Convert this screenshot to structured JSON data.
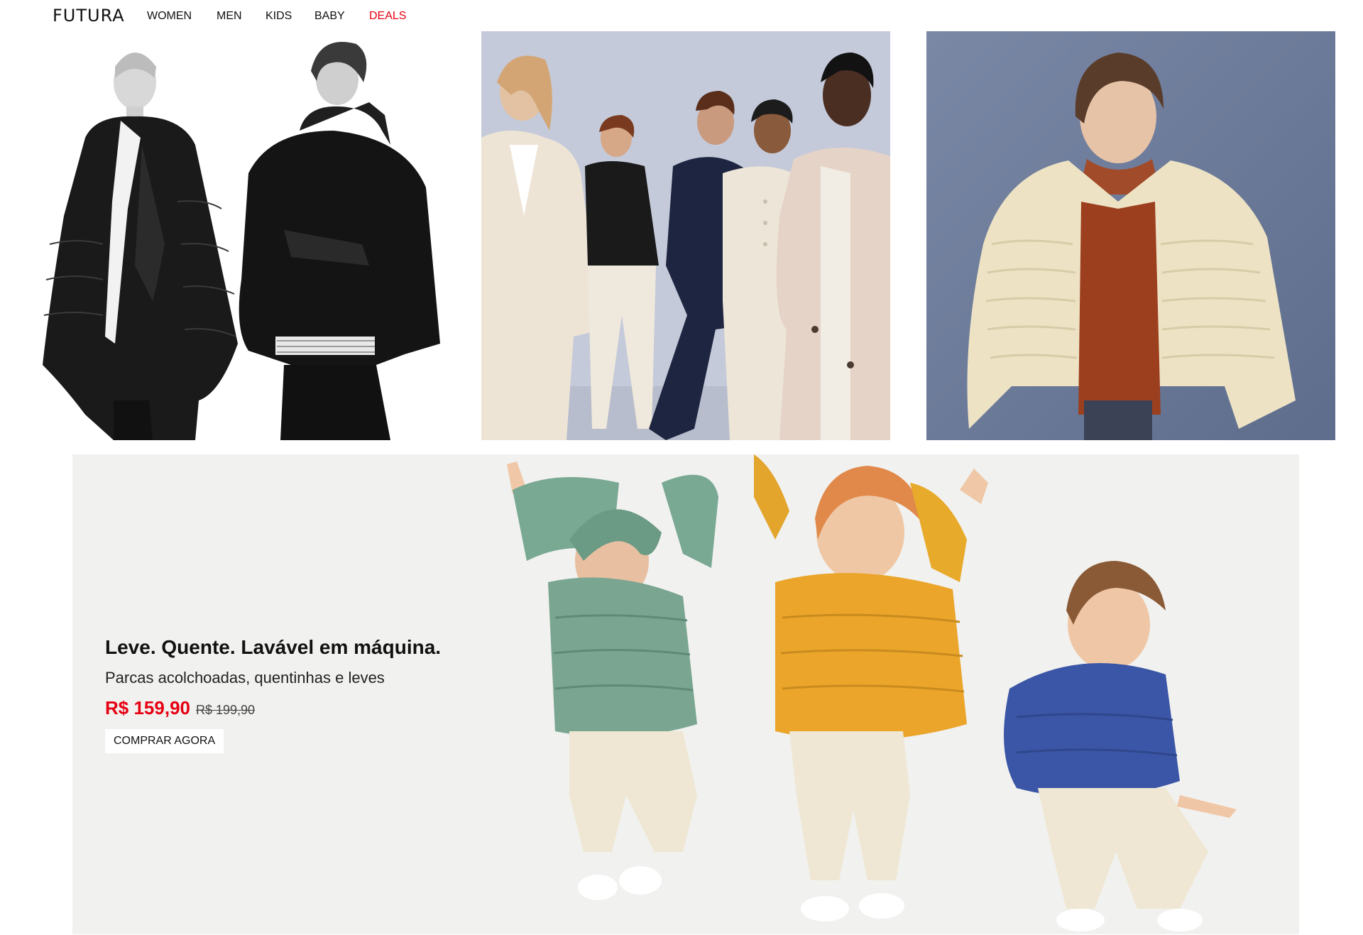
{
  "header": {
    "logo": "FUTURA",
    "nav": {
      "women": "WOMEN",
      "men": "MEN",
      "kids": "KIDS",
      "baby": "BABY",
      "deals": "DEALS"
    }
  },
  "colors": {
    "accent": "#e60012",
    "text": "#111111",
    "hero_bg": "#f1f1ef"
  },
  "tiles": [
    {
      "name": "women-men-outerwear-tile",
      "scene": "two-models-black-puffer-coats"
    },
    {
      "name": "group-models-tile",
      "scene": "five-models-neutral-outfits"
    },
    {
      "name": "ultra-light-down-tile",
      "scene": "woman-cream-puffer-jacket"
    }
  ],
  "hero": {
    "headline": "Leve. Quente. Lavável em máquina.",
    "subheadline": "Parcas acolchoadas, quentinhas e leves",
    "price_now": "R$ 159,90",
    "price_old": "R$ 199,90",
    "cta_label": "COMPRAR AGORA"
  }
}
